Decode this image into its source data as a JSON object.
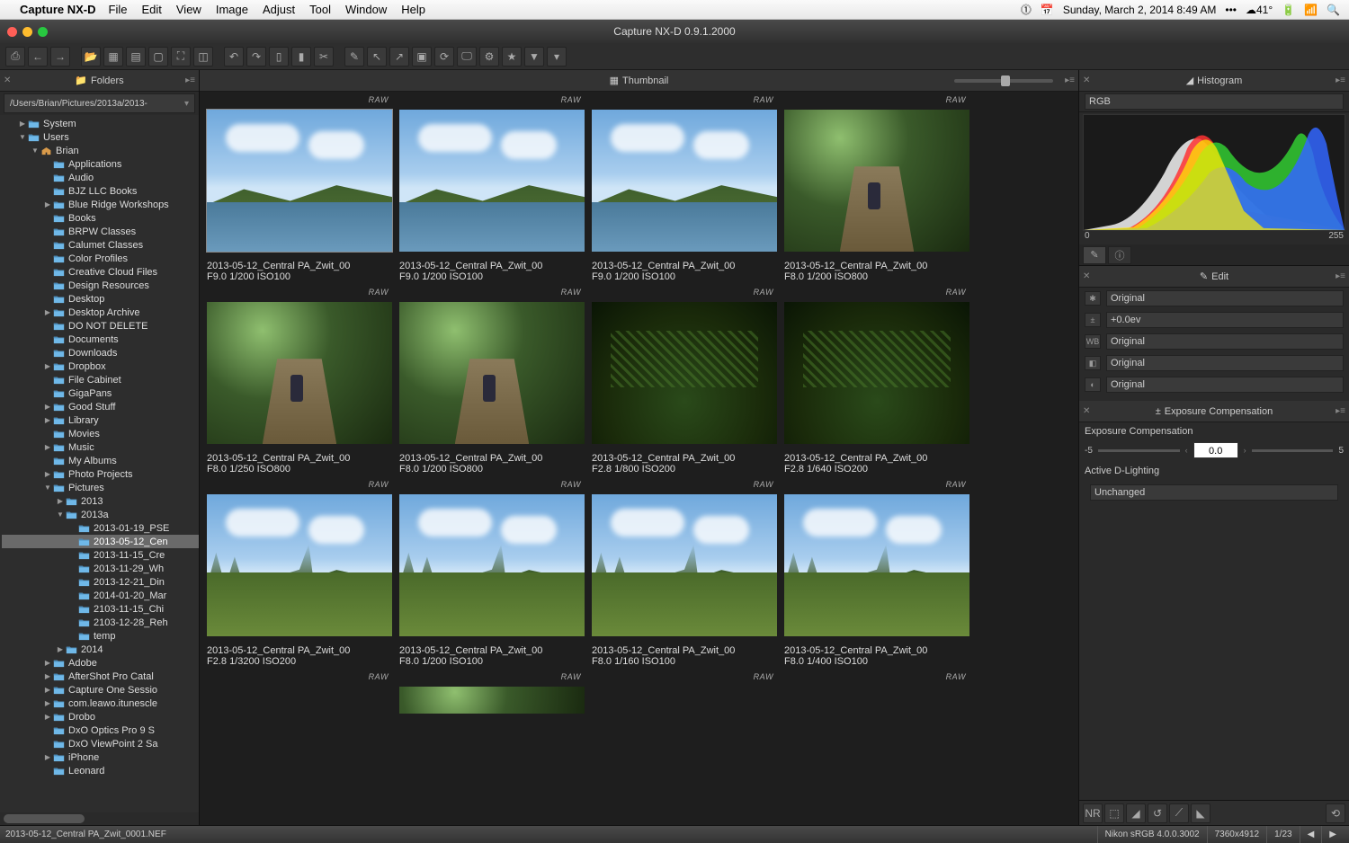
{
  "menubar": {
    "app": "Capture NX-D",
    "items": [
      "File",
      "Edit",
      "View",
      "Image",
      "Adjust",
      "Tool",
      "Window",
      "Help"
    ],
    "date": "Sunday, March 2, 2014 8:49 AM",
    "temp": "41°"
  },
  "window_title": "Capture NX-D 0.9.1.2000",
  "folders": {
    "title": "Folders",
    "path": "/Users/Brian/Pictures/2013a/2013-",
    "tree": [
      {
        "d": 1,
        "exp": "▶",
        "label": "System"
      },
      {
        "d": 1,
        "exp": "▼",
        "label": "Users"
      },
      {
        "d": 2,
        "exp": "▼",
        "label": "Brian",
        "home": true
      },
      {
        "d": 3,
        "exp": "",
        "label": "Applications"
      },
      {
        "d": 3,
        "exp": "",
        "label": "Audio"
      },
      {
        "d": 3,
        "exp": "",
        "label": "BJZ LLC Books"
      },
      {
        "d": 3,
        "exp": "▶",
        "label": "Blue Ridge Workshops"
      },
      {
        "d": 3,
        "exp": "",
        "label": "Books"
      },
      {
        "d": 3,
        "exp": "",
        "label": "BRPW Classes"
      },
      {
        "d": 3,
        "exp": "",
        "label": "Calumet Classes"
      },
      {
        "d": 3,
        "exp": "",
        "label": "Color Profiles"
      },
      {
        "d": 3,
        "exp": "",
        "label": "Creative Cloud Files"
      },
      {
        "d": 3,
        "exp": "",
        "label": "Design Resources"
      },
      {
        "d": 3,
        "exp": "",
        "label": "Desktop"
      },
      {
        "d": 3,
        "exp": "▶",
        "label": "Desktop Archive"
      },
      {
        "d": 3,
        "exp": "",
        "label": "DO NOT DELETE"
      },
      {
        "d": 3,
        "exp": "",
        "label": "Documents"
      },
      {
        "d": 3,
        "exp": "",
        "label": "Downloads"
      },
      {
        "d": 3,
        "exp": "▶",
        "label": "Dropbox"
      },
      {
        "d": 3,
        "exp": "",
        "label": "File Cabinet"
      },
      {
        "d": 3,
        "exp": "",
        "label": "GigaPans"
      },
      {
        "d": 3,
        "exp": "▶",
        "label": "Good Stuff"
      },
      {
        "d": 3,
        "exp": "▶",
        "label": "Library"
      },
      {
        "d": 3,
        "exp": "",
        "label": "Movies"
      },
      {
        "d": 3,
        "exp": "▶",
        "label": "Music"
      },
      {
        "d": 3,
        "exp": "",
        "label": "My Albums"
      },
      {
        "d": 3,
        "exp": "▶",
        "label": "Photo Projects"
      },
      {
        "d": 3,
        "exp": "▼",
        "label": "Pictures"
      },
      {
        "d": 4,
        "exp": "▶",
        "label": "2013"
      },
      {
        "d": 4,
        "exp": "▼",
        "label": "2013a"
      },
      {
        "d": 5,
        "exp": "",
        "label": "2013-01-19_PSE"
      },
      {
        "d": 5,
        "exp": "",
        "label": "2013-05-12_Cen",
        "sel": true
      },
      {
        "d": 5,
        "exp": "",
        "label": "2013-11-15_Cre"
      },
      {
        "d": 5,
        "exp": "",
        "label": "2013-11-29_Wh"
      },
      {
        "d": 5,
        "exp": "",
        "label": "2013-12-21_Din"
      },
      {
        "d": 5,
        "exp": "",
        "label": "2014-01-20_Mar"
      },
      {
        "d": 5,
        "exp": "",
        "label": "2103-11-15_Chi"
      },
      {
        "d": 5,
        "exp": "",
        "label": "2103-12-28_Reh"
      },
      {
        "d": 5,
        "exp": "",
        "label": "temp"
      },
      {
        "d": 4,
        "exp": "▶",
        "label": "2014"
      },
      {
        "d": 3,
        "exp": "▶",
        "label": "Adobe"
      },
      {
        "d": 3,
        "exp": "▶",
        "label": "AfterShot Pro Catal"
      },
      {
        "d": 3,
        "exp": "▶",
        "label": "Capture One Sessio"
      },
      {
        "d": 3,
        "exp": "▶",
        "label": "com.leawo.itunescle"
      },
      {
        "d": 3,
        "exp": "▶",
        "label": "Drobo"
      },
      {
        "d": 3,
        "exp": "",
        "label": "DxO Optics Pro 9 S"
      },
      {
        "d": 3,
        "exp": "",
        "label": "DxO ViewPoint 2 Sa"
      },
      {
        "d": 3,
        "exp": "▶",
        "label": "iPhone"
      },
      {
        "d": 3,
        "exp": "",
        "label": "Leonard"
      }
    ]
  },
  "thumbnail_header": "Thumbnail",
  "raw_label": "RAW",
  "thumbs": [
    [
      {
        "scene": "lake",
        "name": "2013-05-12_Central PA_Zwit_00",
        "meta": "F9.0  1/200   ISO100",
        "sel": true
      },
      {
        "scene": "lake",
        "name": "2013-05-12_Central PA_Zwit_00",
        "meta": "F9.0  1/200   ISO100"
      },
      {
        "scene": "lake",
        "name": "2013-05-12_Central PA_Zwit_00",
        "meta": "F9.0  1/200   ISO100"
      },
      {
        "scene": "forest",
        "name": "2013-05-12_Central PA_Zwit_00",
        "meta": "F8.0  1/200   ISO800"
      }
    ],
    [
      {
        "scene": "forest",
        "name": "2013-05-12_Central PA_Zwit_00",
        "meta": "F8.0  1/250   ISO800"
      },
      {
        "scene": "forest",
        "name": "2013-05-12_Central PA_Zwit_00",
        "meta": "F8.0  1/200   ISO800"
      },
      {
        "scene": "fern",
        "name": "2013-05-12_Central PA_Zwit_00",
        "meta": "F2.8  1/800   ISO200"
      },
      {
        "scene": "fern",
        "name": "2013-05-12_Central PA_Zwit_00",
        "meta": "F2.8  1/640   ISO200"
      }
    ],
    [
      {
        "scene": "meadow",
        "name": "2013-05-12_Central PA_Zwit_00",
        "meta": "F2.8  1/3200   ISO200"
      },
      {
        "scene": "meadow",
        "name": "2013-05-12_Central PA_Zwit_00",
        "meta": "F8.0  1/200   ISO100"
      },
      {
        "scene": "meadow",
        "name": "2013-05-12_Central PA_Zwit_00",
        "meta": "F8.0  1/160   ISO100"
      },
      {
        "scene": "meadow",
        "name": "2013-05-12_Central PA_Zwit_00",
        "meta": "F8.0  1/400   ISO100"
      }
    ]
  ],
  "right": {
    "histogram_title": "Histogram",
    "rgb": "RGB",
    "scale_min": "0",
    "scale_max": "255",
    "edit_title": "Edit",
    "rows": [
      {
        "ico": "✱",
        "val": "Original"
      },
      {
        "ico": "±",
        "val": "+0.0ev"
      },
      {
        "ico": "WB",
        "val": "Original"
      },
      {
        "ico": "◧",
        "val": "Original"
      },
      {
        "ico": "◐",
        "val": "Original"
      }
    ],
    "expo_title": "Exposure Compensation",
    "expo_label": "Exposure Compensation",
    "expo_min": "-5",
    "expo_val": "0.0",
    "expo_max": "5",
    "adl_label": "Active D-Lighting",
    "adl_val": "Unchanged"
  },
  "status": {
    "file": "2013-05-12_Central PA_Zwit_0001.NEF",
    "profile": "Nikon sRGB 4.0.0.3002",
    "dims": "7360x4912",
    "pos": "1/23"
  }
}
